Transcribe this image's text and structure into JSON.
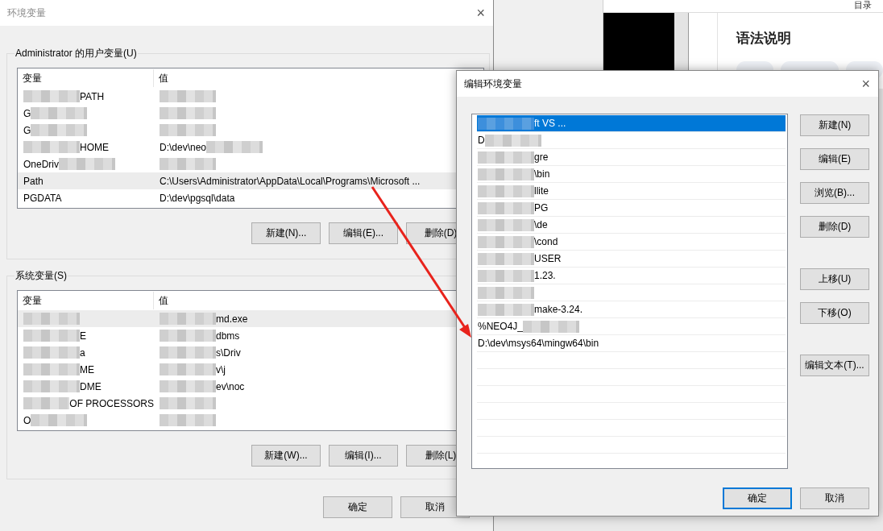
{
  "background_page": {
    "toc_link": "目录",
    "heading": "语法说明",
    "chips": [
      {
        "kind": "chip"
      },
      {
        "kind": "chip"
      },
      {
        "kind": "chip"
      }
    ]
  },
  "main_window": {
    "title": "环境变量",
    "close": "×",
    "user_group": {
      "label": "Administrator 的用户变量(U)",
      "columns": [
        "变量",
        "值"
      ],
      "rows": [
        {
          "name": "PATH",
          "name_blur_before": true,
          "value_blur_after": true,
          "selected": false
        },
        {
          "name": "G",
          "name_blur_after": true,
          "value_blur_after": true,
          "selected": false
        },
        {
          "name": "G",
          "name_blur_after": true,
          "value_blur_after": true,
          "selected": false
        },
        {
          "name": "HOME",
          "name_blur_before": true,
          "value": "D:\\dev\\neo",
          "value_blur_after": true,
          "selected": false
        },
        {
          "name": "OneDriv",
          "name_blur_after": true,
          "value_blur_after": true,
          "selected": false
        },
        {
          "name": "Path",
          "value": "C:\\Users\\Administrator\\AppData\\Local\\Programs\\Microsoft ...",
          "selected": true
        },
        {
          "name": "PGDATA",
          "value": "D:\\dev\\pgsql\\data",
          "selected": false
        }
      ],
      "buttons": [
        "新建(N)...",
        "编辑(E)...",
        "删除(D)"
      ]
    },
    "system_group": {
      "label": "系统变量(S)",
      "columns": [
        "变量",
        "值"
      ],
      "rows": [
        {
          "name_blur_before": true,
          "value": "md.exe",
          "value_blur_before": true,
          "selected": true
        },
        {
          "name": "E",
          "name_blur_before": true,
          "value": "dbms",
          "value_blur_before": true,
          "selected": false
        },
        {
          "name": "a",
          "name_blur_before": true,
          "value": "s\\Driv",
          "value_blur_before": true,
          "selected": false
        },
        {
          "name": "ME",
          "name_blur_before": true,
          "value": "v\\j",
          "value_blur_before": true,
          "selected": false
        },
        {
          "name": "DME",
          "name_blur_before": true,
          "value": "ev\\noc",
          "value_blur_before": true,
          "selected": false
        },
        {
          "name": "OF PROCESSORS",
          "name_blur_before": true,
          "value_blur_before": true,
          "selected": false
        },
        {
          "name": "O",
          "name_blur_after": true,
          "value_blur_before": true,
          "selected": false
        }
      ],
      "buttons": [
        "新建(W)...",
        "编辑(I)...",
        "删除(L)"
      ]
    },
    "buttons": [
      "确定",
      "取消"
    ]
  },
  "edit_window": {
    "title": "编辑环境变量",
    "close": "×",
    "entries": [
      {
        "text": "ft VS ...",
        "blur_before": true,
        "selected": true
      },
      {
        "text": "D",
        "blur_after": true,
        "selected": false
      },
      {
        "text": "gre",
        "blur_before": true,
        "selected": false
      },
      {
        "text": "\\bin",
        "blur_before": true,
        "selected": false
      },
      {
        "text": "llite",
        "blur_before": true,
        "selected": false
      },
      {
        "text": "PG",
        "blur_before": true,
        "selected": false
      },
      {
        "text": "\\de",
        "blur_before": true,
        "selected": false
      },
      {
        "text": "\\cond",
        "blur_before": true,
        "selected": false
      },
      {
        "text": "USER",
        "blur_before": true,
        "selected": false
      },
      {
        "text": "1.23.",
        "blur_before": true,
        "selected": false
      },
      {
        "blur_after": true,
        "selected": false
      },
      {
        "text": "make-3.24.",
        "blur_before": true,
        "selected": false
      },
      {
        "text": "%NEO4J_",
        "blur_after": true,
        "selected": false
      },
      {
        "text": "D:\\dev\\msys64\\mingw64\\bin",
        "selected": false
      }
    ],
    "side_button_groups": [
      [
        "新建(N)",
        "编辑(E)",
        "浏览(B)...",
        "删除(D)"
      ],
      [
        "上移(U)",
        "下移(O)"
      ],
      [
        "编辑文本(T)..."
      ]
    ],
    "buttons": [
      {
        "label": "确定",
        "focused": true
      },
      {
        "label": "取消",
        "focused": false
      }
    ]
  }
}
